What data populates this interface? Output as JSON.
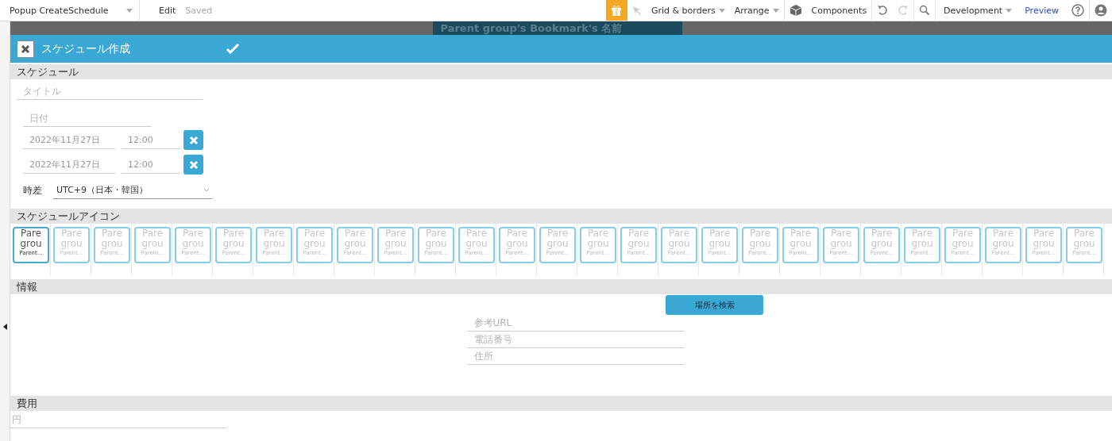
{
  "toolbar": {
    "page_selector": "Popup CreateSchedule",
    "edit": "Edit",
    "save_status": "Saved",
    "grid": "Grid & borders",
    "arrange": "Arrange",
    "components": "Components",
    "environment": "Development",
    "preview": "Preview"
  },
  "canvas_tab": "Parent group's Bookmark's 名前",
  "popup": {
    "title": "スケジュール作成"
  },
  "schedule": {
    "header": "スケジュール",
    "title_placeholder": "タイトル",
    "date_placeholder": "日付",
    "rows": [
      {
        "date": "2022年11月27日",
        "time": "12:00"
      },
      {
        "date": "2022年11月27日",
        "time": "12:00"
      }
    ],
    "timezone_label": "時差",
    "timezone": "UTC+9（日本・韓国）"
  },
  "icons": {
    "header": "スケジュールアイコン",
    "tiles": [
      {
        "line_1": "Pare",
        "line_2": "grou",
        "caption": "Parent…",
        "selected": true
      },
      {
        "line_1": "Pare",
        "line_2": "grou",
        "caption": "Parent…",
        "selected": false
      },
      {
        "line_1": "Pare",
        "line_2": "grou",
        "caption": "Parent…",
        "selected": false
      },
      {
        "line_1": "Pare",
        "line_2": "grou",
        "caption": "Parent…",
        "selected": false
      },
      {
        "line_1": "Pare",
        "line_2": "grou",
        "caption": "Parent…",
        "selected": false
      },
      {
        "line_1": "Pare",
        "line_2": "grou",
        "caption": "Parent…",
        "selected": false
      },
      {
        "line_1": "Pare",
        "line_2": "grou",
        "caption": "Parent…",
        "selected": false
      },
      {
        "line_1": "Pare",
        "line_2": "grou",
        "caption": "Parent…",
        "selected": false
      },
      {
        "line_1": "Pare",
        "line_2": "grou",
        "caption": "Parent…",
        "selected": false
      },
      {
        "line_1": "Pare",
        "line_2": "grou",
        "caption": "Parent…",
        "selected": false
      },
      {
        "line_1": "Pare",
        "line_2": "grou",
        "caption": "Parent…",
        "selected": false
      },
      {
        "line_1": "Pare",
        "line_2": "grou",
        "caption": "Parent…",
        "selected": false
      },
      {
        "line_1": "Pare",
        "line_2": "grou",
        "caption": "Parent…",
        "selected": false
      },
      {
        "line_1": "Pare",
        "line_2": "grou",
        "caption": "Parent…",
        "selected": false
      },
      {
        "line_1": "Pare",
        "line_2": "grou",
        "caption": "Parent…",
        "selected": false
      },
      {
        "line_1": "Pare",
        "line_2": "grou",
        "caption": "Parent…",
        "selected": false
      },
      {
        "line_1": "Pare",
        "line_2": "grou",
        "caption": "Parent…",
        "selected": false
      },
      {
        "line_1": "Pare",
        "line_2": "grou",
        "caption": "Parent…",
        "selected": false
      },
      {
        "line_1": "Pare",
        "line_2": "grou",
        "caption": "Parent…",
        "selected": false
      },
      {
        "line_1": "Pare",
        "line_2": "grou",
        "caption": "Parent…",
        "selected": false
      },
      {
        "line_1": "Pare",
        "line_2": "grou",
        "caption": "Parent…",
        "selected": false
      },
      {
        "line_1": "Pare",
        "line_2": "grou",
        "caption": "Parent…",
        "selected": false
      },
      {
        "line_1": "Pare",
        "line_2": "grou",
        "caption": "Parent…",
        "selected": false
      },
      {
        "line_1": "Pare",
        "line_2": "grou",
        "caption": "Parent…",
        "selected": false
      },
      {
        "line_1": "Pare",
        "line_2": "grou",
        "caption": "Parent…",
        "selected": false
      },
      {
        "line_1": "Pare",
        "line_2": "grou",
        "caption": "Parent…",
        "selected": false
      },
      {
        "line_1": "Pare",
        "line_2": "grou",
        "caption": "Parent…",
        "selected": false
      }
    ]
  },
  "info": {
    "header": "情報",
    "search_button": "場所を検索",
    "fields": [
      {
        "placeholder": "参考URL"
      },
      {
        "placeholder": "電話番号"
      },
      {
        "placeholder": "住所"
      }
    ]
  },
  "cost": {
    "header": "費用",
    "placeholder": "円"
  }
}
